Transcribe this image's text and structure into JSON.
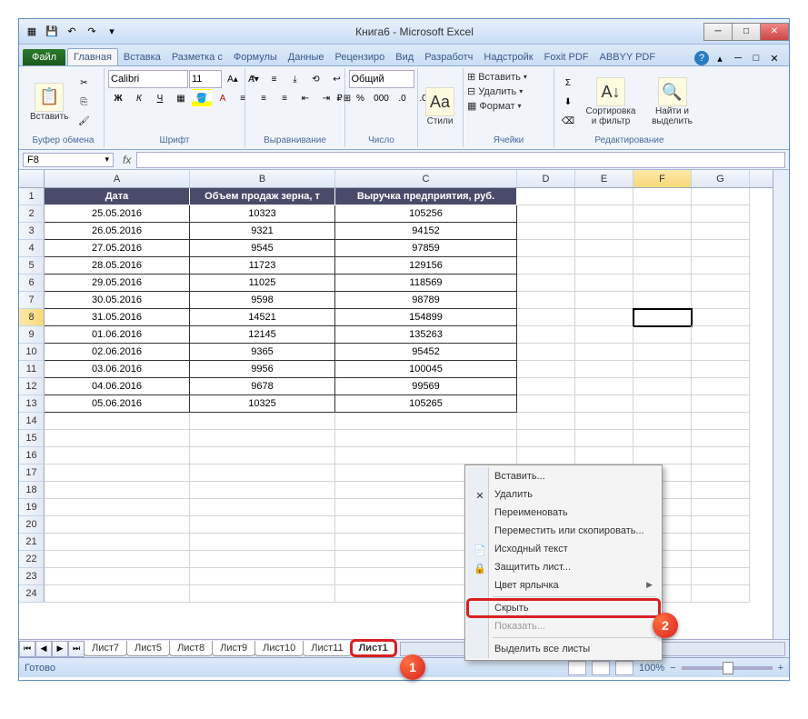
{
  "window": {
    "title": "Книга6 - Microsoft Excel"
  },
  "tabs": {
    "file": "Файл",
    "items": [
      "Главная",
      "Вставка",
      "Разметка с",
      "Формулы",
      "Данные",
      "Рецензиро",
      "Вид",
      "Разработч",
      "Надстройк",
      "Foxit PDF",
      "ABBYY PDF"
    ]
  },
  "ribbon": {
    "clipboard": {
      "paste": "Вставить",
      "label": "Буфер обмена"
    },
    "font": {
      "name": "Calibri",
      "size": "11",
      "label": "Шрифт"
    },
    "alignment": {
      "label": "Выравнивание"
    },
    "number": {
      "format": "Общий",
      "label": "Число"
    },
    "styles": {
      "btn": "Стили",
      "label": ""
    },
    "cells": {
      "insert": "Вставить",
      "delete": "Удалить",
      "format": "Формат",
      "label": "Ячейки"
    },
    "editing": {
      "sort": "Сортировка и фильтр",
      "find": "Найти и выделить",
      "label": "Редактирование"
    }
  },
  "namebox": "F8",
  "columns": [
    "A",
    "B",
    "C",
    "D",
    "E",
    "F",
    "G"
  ],
  "headers": [
    "Дата",
    "Объем продаж зерна, т",
    "Выручка предприятия, руб."
  ],
  "rows": [
    {
      "n": 1
    },
    {
      "n": 2,
      "d": [
        "25.05.2016",
        "10323",
        "105256"
      ]
    },
    {
      "n": 3,
      "d": [
        "26.05.2016",
        "9321",
        "94152"
      ]
    },
    {
      "n": 4,
      "d": [
        "27.05.2016",
        "9545",
        "97859"
      ]
    },
    {
      "n": 5,
      "d": [
        "28.05.2016",
        "11723",
        "129156"
      ]
    },
    {
      "n": 6,
      "d": [
        "29.05.2016",
        "11025",
        "118569"
      ]
    },
    {
      "n": 7,
      "d": [
        "30.05.2016",
        "9598",
        "98789"
      ]
    },
    {
      "n": 8,
      "d": [
        "31.05.2016",
        "14521",
        "154899"
      ]
    },
    {
      "n": 9,
      "d": [
        "01.06.2016",
        "12145",
        "135263"
      ]
    },
    {
      "n": 10,
      "d": [
        "02.06.2016",
        "9365",
        "95452"
      ]
    },
    {
      "n": 11,
      "d": [
        "03.06.2016",
        "9956",
        "100045"
      ]
    },
    {
      "n": 12,
      "d": [
        "04.06.2016",
        "9678",
        "99569"
      ]
    },
    {
      "n": 13,
      "d": [
        "05.06.2016",
        "10325",
        "105265"
      ]
    },
    {
      "n": 14
    },
    {
      "n": 15
    },
    {
      "n": 16
    },
    {
      "n": 17
    },
    {
      "n": 18
    },
    {
      "n": 19
    },
    {
      "n": 20
    },
    {
      "n": 21
    },
    {
      "n": 22
    },
    {
      "n": 23
    },
    {
      "n": 24
    }
  ],
  "sheets": [
    "Лист7",
    "Лист5",
    "Лист8",
    "Лист9",
    "Лист10",
    "Лист11",
    "Лист1"
  ],
  "context_menu": [
    {
      "label": "Вставить...",
      "icon": ""
    },
    {
      "label": "Удалить",
      "icon": "✕"
    },
    {
      "label": "Переименовать",
      "icon": ""
    },
    {
      "label": "Переместить или скопировать...",
      "icon": ""
    },
    {
      "label": "Исходный текст",
      "icon": "📄"
    },
    {
      "label": "Защитить лист...",
      "icon": "🔒"
    },
    {
      "label": "Цвет ярлычка",
      "icon": "",
      "arrow": true
    },
    {
      "sep": true
    },
    {
      "label": "Скрыть",
      "icon": "",
      "highlight": true
    },
    {
      "label": "Показать...",
      "icon": "",
      "disabled": true
    },
    {
      "sep": true
    },
    {
      "label": "Выделить все листы",
      "icon": ""
    }
  ],
  "status": {
    "ready": "Готово",
    "zoom": "100%"
  },
  "callouts": {
    "c1": "1",
    "c2": "2"
  }
}
